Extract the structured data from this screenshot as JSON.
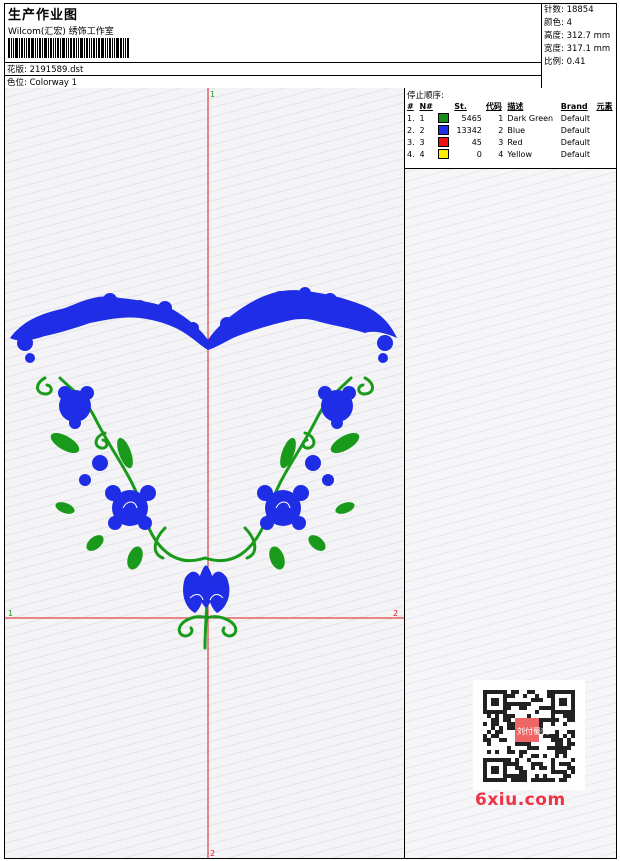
{
  "header": {
    "title": "生产作业图",
    "company": "Wilcom(汇宏) 绣饰工作室",
    "pattern_label": "花版:",
    "pattern_value": "2191589.dst",
    "colorway_label": "色位:",
    "colorway_value": "Colorway 1"
  },
  "stats": {
    "stitches": "针数: 18854",
    "colors": "颜色: 4",
    "height": "高度: 312.7 mm",
    "width": "宽度: 317.1 mm",
    "scale": "比例: 0.41"
  },
  "stop_sequence": {
    "title": "停止顺序:",
    "headers": [
      "#",
      "N#",
      "St.",
      "代码",
      "描述",
      "Brand",
      "元素"
    ],
    "rows": [
      {
        "idx": "1.",
        "n": "1",
        "color": "#1a8a1a",
        "st": "5465",
        "code": "1",
        "desc": "Dark Green",
        "brand": "Default"
      },
      {
        "idx": "2.",
        "n": "2",
        "color": "#1f2ee6",
        "st": "13342",
        "code": "2",
        "desc": "Blue",
        "brand": "Default"
      },
      {
        "idx": "3.",
        "n": "3",
        "color": "#ee1111",
        "st": "45",
        "code": "3",
        "desc": "Red",
        "brand": "Default"
      },
      {
        "idx": "4.",
        "n": "4",
        "color": "#ffee00",
        "st": "0",
        "code": "4",
        "desc": "Yellow",
        "brand": "Default"
      }
    ]
  },
  "axes": {
    "top_label": "1",
    "bottom_label": "2",
    "left_label": "1",
    "right_label": "2",
    "axis_color": "#e01818"
  },
  "watermark": "6xiu.com",
  "qr_stamp": "刘付蜀刺",
  "colors": {
    "embroidery_blue": "#1f2ee6",
    "embroidery_green": "#1a9a1a"
  }
}
